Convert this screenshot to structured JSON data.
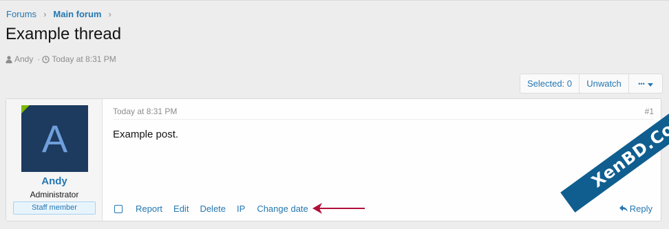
{
  "breadcrumb": {
    "items": [
      "Forums",
      "Main forum"
    ]
  },
  "thread": {
    "title": "Example thread",
    "author": "Andy",
    "separator": "·",
    "date": "Today at 8:31 PM"
  },
  "toolbar": {
    "selected_label": "Selected: 0",
    "unwatch_label": "Unwatch",
    "more_label": "•••"
  },
  "post": {
    "avatar_letter": "A",
    "username": "Andy",
    "user_title": "Administrator",
    "badge": "Staff member",
    "date": "Today at 8:31 PM",
    "number": "#1",
    "body": "Example post.",
    "actions": [
      "Report",
      "Edit",
      "Delete",
      "IP",
      "Change date"
    ],
    "reply_label": "Reply"
  },
  "watermark": {
    "text": "XenBD.Com"
  },
  "colors": {
    "link": "#2577b1",
    "muted": "#8c8c8c",
    "avatar_bg": "#1d3a5f",
    "online": "#7fb900",
    "arrow": "#b0103a",
    "watermark_bg": "#0f5e8f"
  },
  "icons": {
    "author": "user-icon",
    "date": "clock-icon",
    "reply": "reply-icon",
    "dropdown": "caret-down-icon"
  }
}
